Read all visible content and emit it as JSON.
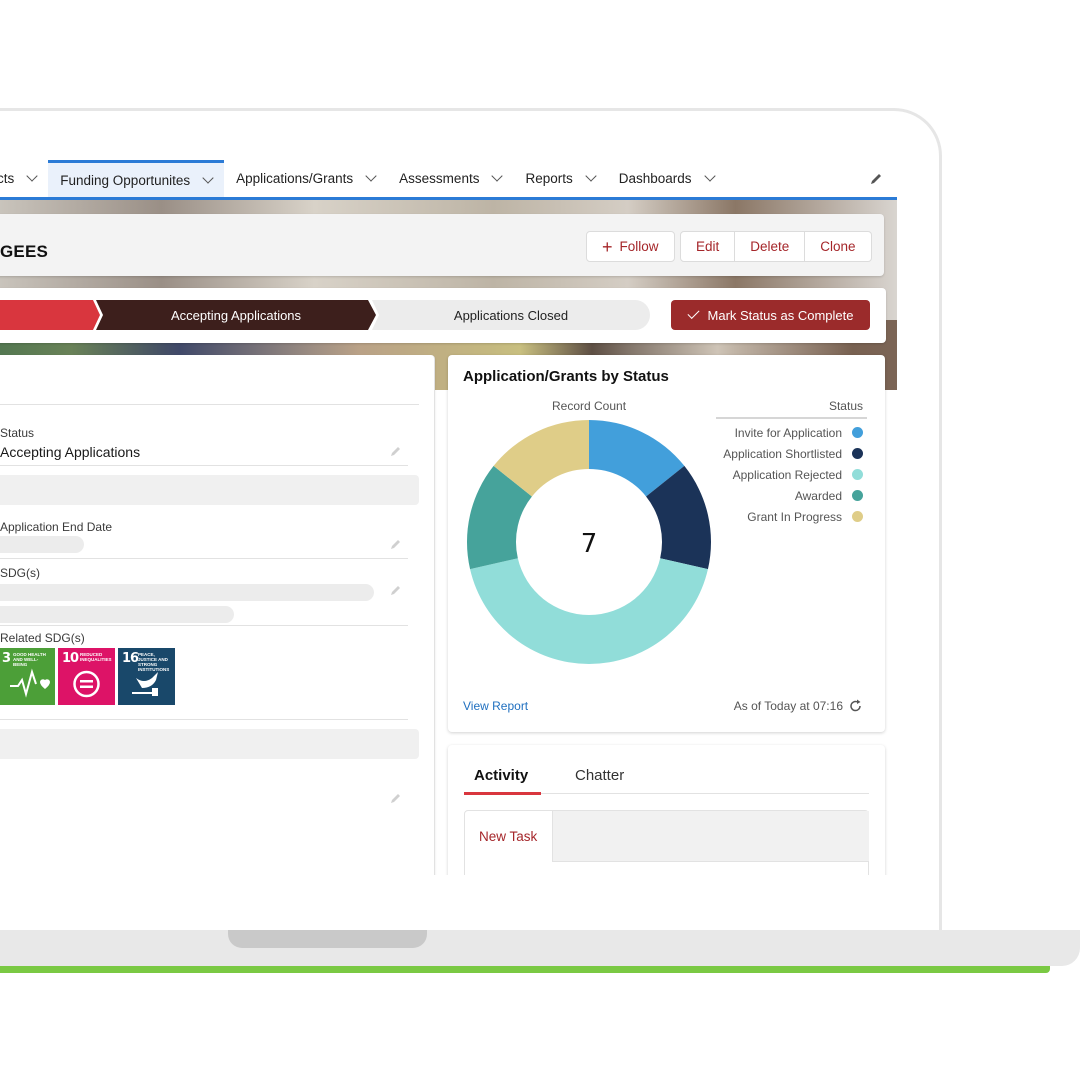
{
  "nav": {
    "items": [
      {
        "label": "cts",
        "active": false
      },
      {
        "label": "Funding Opportunites",
        "active": true
      },
      {
        "label": "Applications/Grants",
        "active": false
      },
      {
        "label": "Assessments",
        "active": false
      },
      {
        "label": "Reports",
        "active": false
      },
      {
        "label": "Dashboards",
        "active": false
      }
    ],
    "edit_icon": "pencil-icon"
  },
  "header": {
    "record_title": "GEES",
    "buttons": {
      "follow": "Follow",
      "edit": "Edit",
      "delete": "Delete",
      "clone": "Clone"
    }
  },
  "path": {
    "steps": [
      {
        "label": "",
        "state": "complete"
      },
      {
        "label": "Accepting Applications",
        "state": "current"
      },
      {
        "label": "Applications Closed",
        "state": "upcoming"
      }
    ],
    "mark_complete_label": "Mark Status as Complete"
  },
  "details": {
    "status_label": "Status",
    "status_value": "Accepting Applications",
    "end_date_label": "Application End Date",
    "sdgs_label": "SDG(s)",
    "related_sdgs_label": "Related SDG(s)",
    "related_sdgs": [
      {
        "number": "3",
        "title": "Good Health and Well-Being",
        "color": "#4c9f38"
      },
      {
        "number": "10",
        "title": "Reduced Inequalities",
        "color": "#dd1367"
      },
      {
        "number": "16",
        "title": "Peace, Justice and Strong Institutions",
        "color": "#19486a"
      }
    ]
  },
  "chart_card": {
    "title": "Application/Grants by Status",
    "view_report": "View Report",
    "as_of": "As of Today at 07:16"
  },
  "chart_data": {
    "type": "pie",
    "variant": "donut",
    "title": "Application/Grants by Status",
    "subtitle": "Record Count",
    "legend_title": "Status",
    "legend_position": "right",
    "total": 7,
    "series": [
      {
        "name": "Invite for Application",
        "value": 1,
        "color": "#429fdb"
      },
      {
        "name": "Application Shortlisted",
        "value": 1,
        "color": "#1b3358"
      },
      {
        "name": "Application Rejected",
        "value": 3,
        "color": "#91ddd9"
      },
      {
        "name": "Awarded",
        "value": 1,
        "color": "#46a39b"
      },
      {
        "name": "Grant In Progress",
        "value": 1,
        "color": "#dfcd88"
      }
    ]
  },
  "activity": {
    "tabs": [
      "Activity",
      "Chatter"
    ],
    "active_tab": "Activity",
    "new_task": "New Task"
  },
  "colors": {
    "nav_accent": "#2b7bd6",
    "brand_red": "#a5262a",
    "path_complete": "#d9363e",
    "path_current": "#3d1f1c",
    "mark_complete_bg": "#9b2b2b",
    "laptop_accent": "#7ac943"
  }
}
